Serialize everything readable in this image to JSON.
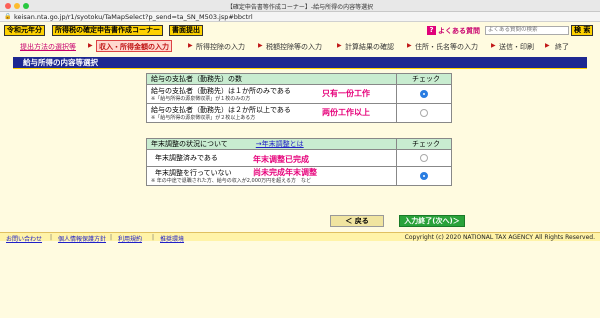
{
  "window": {
    "title": "【確定申告書等作成コーナー】-給与所得の内容等選択"
  },
  "browser": {
    "url": "keisan.nta.go.jp/r1/syotoku/TaMapSelect?p_send=ta_SN_M503.jsp#bbctrl"
  },
  "header": {
    "era_label": "令和元年分",
    "corner_label": "所得税の確定申告書作成コーナー",
    "print_label": "書面提出",
    "help_icon": "?",
    "faq_label": "よくある質問",
    "search_placeholder": "よくある質問の検索",
    "search_button": "検 索"
  },
  "steps": {
    "items": [
      "提出方法の選択等",
      "収入・所得金額の入力",
      "所得控除の入力",
      "税額控除等の入力",
      "計算結果の確認",
      "住所・氏名等の入力",
      "送信・印刷",
      "終了"
    ],
    "current_index": 1
  },
  "section_title": "給与所得の内容等選択",
  "employers": {
    "header_label": "給与の支払者（勤務先）の数",
    "check_label": "チェック",
    "rows": [
      {
        "main": "給与の支払者（勤務先）は１か所のみである",
        "sub": "※「給与所得の源泉徴収票」が１枚のみの方",
        "annotation": "只有一份工作",
        "selected": true
      },
      {
        "main": "給与の支払者（勤務先）は２か所以上である",
        "sub": "※「給与所得の源泉徴収票」が２枚以上ある方",
        "annotation": "两份工作以上",
        "selected": false
      }
    ]
  },
  "adjustment": {
    "header_label": "年末調整の状況について",
    "link_label": "→年末調整とは",
    "check_label": "チェック",
    "rows": [
      {
        "main": "年末調整済みである",
        "sub": "",
        "annotation": "年末调整已完成",
        "selected": false
      },
      {
        "main": "年末調整を行っていない",
        "sub": "※ 年の中途で退職された方、給与の収入が2,000万円を超える方　など",
        "annotation": "尚未完成年末调整",
        "selected": true
      }
    ]
  },
  "nav": {
    "back_label": "＜ 戻る",
    "next_label": "入力終了(次へ)＞"
  },
  "footer": {
    "links": [
      "お問い合わせ",
      "個人情報保護方針",
      "利用規約",
      "推奨環境"
    ],
    "copyright": "Copyright (c) 2020 NATIONAL TAX AGENCY All Rights Reserved."
  },
  "colors": {
    "accent_pink": "#e6007a",
    "title_blue": "#1e2891",
    "button_yellow": "#ffd200",
    "next_green": "#2aa23a"
  },
  "icons": {
    "lock": "lock-icon",
    "help": "help-question-icon",
    "radio": "radio-button-icon"
  }
}
